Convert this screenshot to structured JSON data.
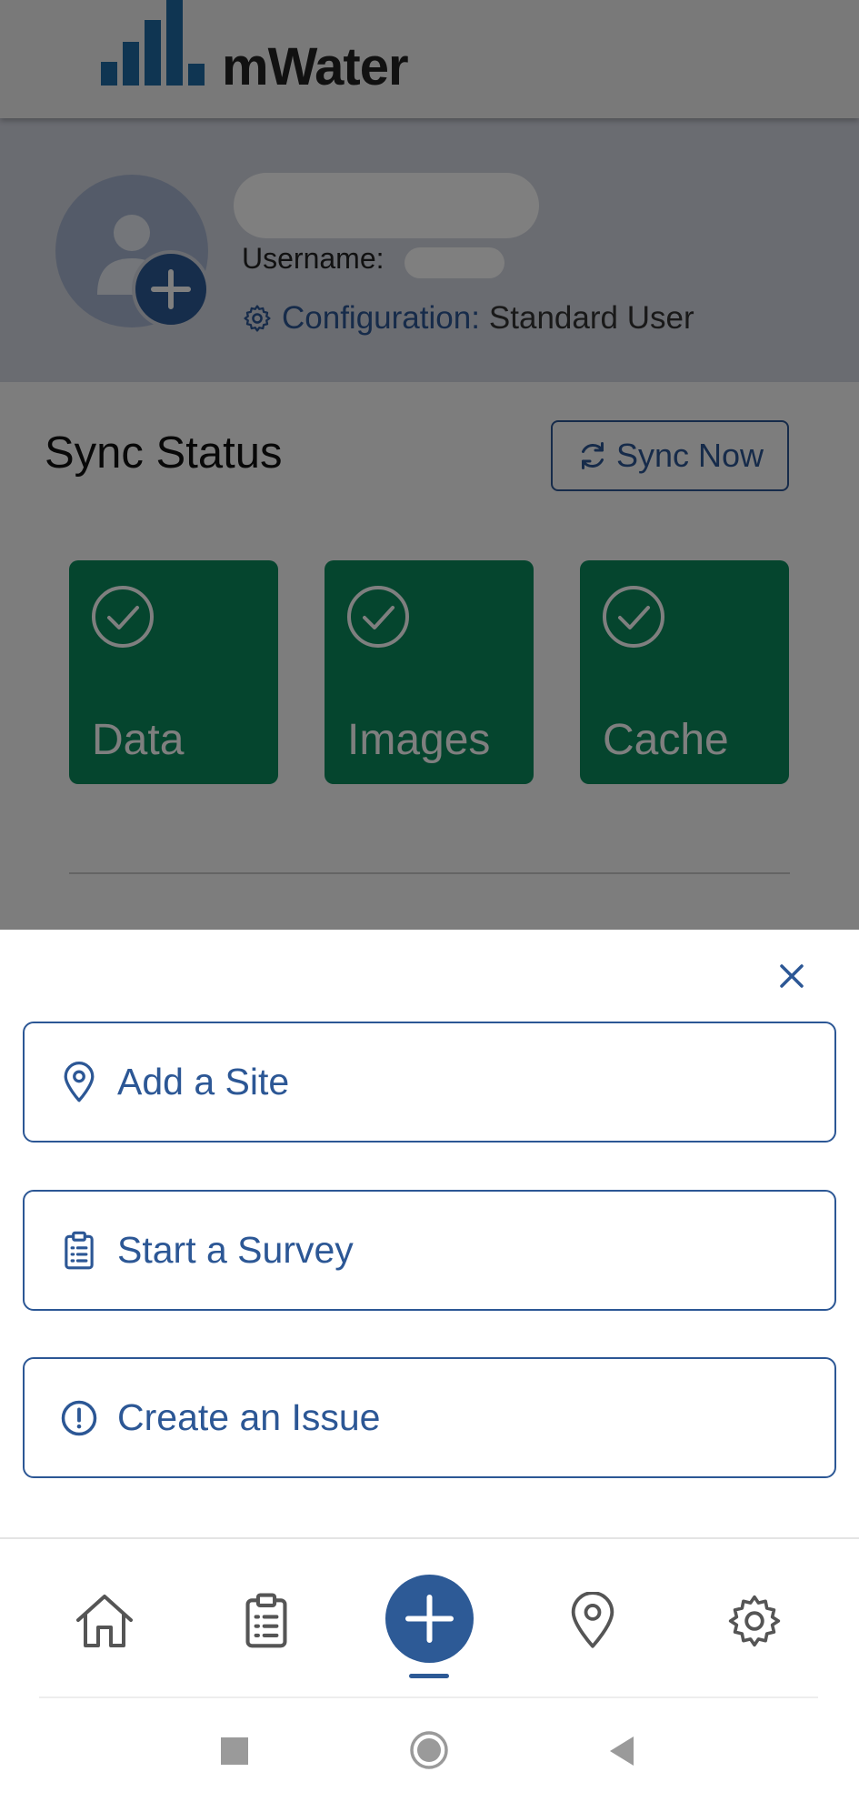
{
  "header": {
    "brand": "mWater",
    "brand_color": "#2c5795"
  },
  "profile": {
    "username_label": "Username:",
    "configuration_label": "Configuration:",
    "configuration_value": "Standard User",
    "avatar_icon": "user-plus-icon"
  },
  "sync": {
    "title": "Sync Status",
    "button_label": "Sync Now",
    "tiles": [
      {
        "label": "Data",
        "status": "ok"
      },
      {
        "label": "Images",
        "status": "ok"
      },
      {
        "label": "Cache",
        "status": "ok"
      }
    ],
    "tile_color": "#0a8a5c"
  },
  "sheet": {
    "close_icon": "close-icon",
    "actions": [
      {
        "label": "Add a Site",
        "icon": "map-pin-icon"
      },
      {
        "label": "Start a Survey",
        "icon": "clipboard-icon"
      },
      {
        "label": "Create an Issue",
        "icon": "alert-circle-icon"
      }
    ]
  },
  "bottom_nav": {
    "items": [
      "home-icon",
      "clipboard-list-icon",
      "plus-icon",
      "map-pin-icon",
      "gear-icon"
    ],
    "active": "plus-icon",
    "accent": "#2d5a96"
  }
}
